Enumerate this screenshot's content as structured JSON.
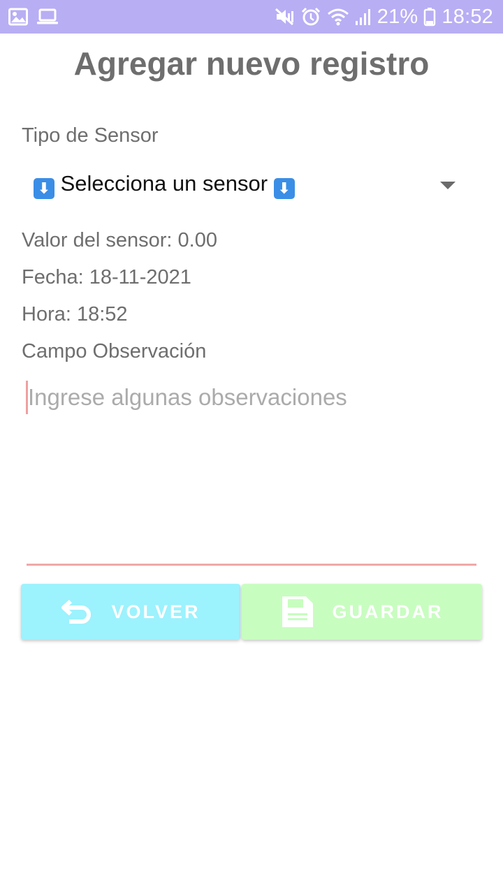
{
  "status_bar": {
    "battery": "21%",
    "time": "18:52",
    "icons": [
      "image-icon",
      "laptop-icon",
      "mute-vibrate-icon",
      "alarm-icon",
      "wifi-icon",
      "signal-icon",
      "battery-icon"
    ],
    "background_color": "#b8aef4"
  },
  "page": {
    "title": "Agregar nuevo registro"
  },
  "form": {
    "sensor_type_label": "Tipo de Sensor",
    "sensor_select": {
      "selected": "Selecciona un sensor",
      "emoji_icon": "arrow-down-emoji-icon"
    },
    "sensor_value": "Valor del sensor: 0.00",
    "date": "Fecha: 18-11-2021",
    "time": "Hora: 18:52",
    "observation_label": "Campo Observación",
    "observation_input": {
      "value": "",
      "placeholder": "Ingrese algunas observaciones"
    }
  },
  "buttons": {
    "back": {
      "label": "VOLVER",
      "icon": "undo-icon",
      "color": "#9cf2fd"
    },
    "save": {
      "label": "GUARDAR",
      "icon": "floppy-disk-icon",
      "color": "#c8fdc0"
    }
  },
  "colors": {
    "accent_underline": "#f0a8a8",
    "text_gray": "#6e6e6e"
  }
}
